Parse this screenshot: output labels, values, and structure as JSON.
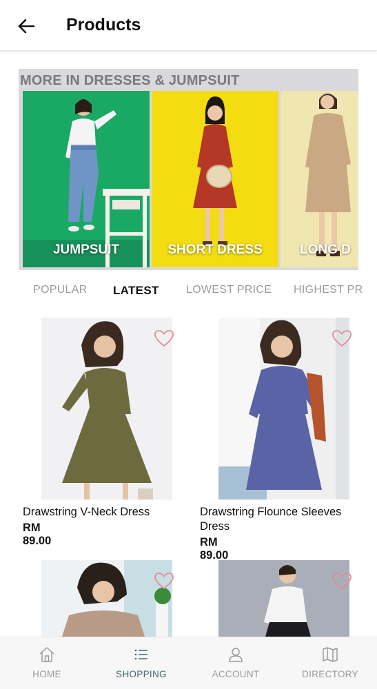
{
  "header": {
    "title": "Products"
  },
  "category_section": {
    "title": "MORE IN DRESSES & JUMPSUIT",
    "cards": [
      {
        "label": "JUMPSUIT",
        "bg": "#1aa865"
      },
      {
        "label": "SHORT DRESS",
        "bg": "#f3dc12"
      },
      {
        "label": "LONG D",
        "bg": "#efe6b0"
      }
    ]
  },
  "sort_tabs": [
    {
      "label": "POPULAR",
      "active": false
    },
    {
      "label": "LATEST",
      "active": true
    },
    {
      "label": "LOWEST PRICE",
      "active": false
    },
    {
      "label": "HIGHEST PR",
      "active": false
    }
  ],
  "products": [
    {
      "name": "Drawstring V-Neck Dress",
      "price": "RM 89.00"
    },
    {
      "name": "Drawstring Flounce Sleeves Dress",
      "price": "RM 89.00"
    },
    {
      "name": "",
      "price": ""
    },
    {
      "name": "",
      "price": ""
    }
  ],
  "bottom_nav": [
    {
      "label": "HOME",
      "icon": "home-icon"
    },
    {
      "label": "SHOPPING",
      "icon": "list-icon",
      "active": true
    },
    {
      "label": "ACCOUNT",
      "icon": "person-icon"
    },
    {
      "label": "DIRECTORY",
      "icon": "map-icon"
    }
  ],
  "colors": {
    "accent_nav": "#3f6b70",
    "heart": "#e38a96",
    "muted_text": "#9a9a9a"
  }
}
